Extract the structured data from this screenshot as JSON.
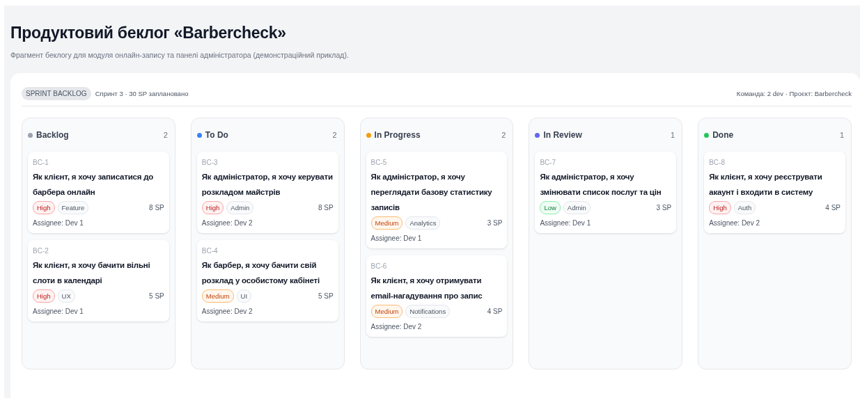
{
  "title": "Продуктовий беклог «Barbercheck»",
  "subtitle": "Фрагмент беклогу для модуля онлайн-запису та панелі адміністратора (демонстраційний приклад).",
  "board": {
    "badge": "SPRINT BACKLOG",
    "sprint": "Спринт 3 · 30 SP заплановано",
    "meta": "Команда: 2 dev · Проєкт: Barbercheck",
    "columns": [
      {
        "name": "Backlog",
        "color": "#9ca3af",
        "count": "2",
        "cards": [
          {
            "id": "BC-1",
            "title": "Як клієнт, я хочу записатися до барбера онлайн",
            "priority": {
              "label": "High",
              "kind": "high"
            },
            "tag": "Feature",
            "points": "8 SP",
            "assignee": "Assignee: Dev 1"
          },
          {
            "id": "BC-2",
            "title": "Як клієнт, я хочу бачити вільні слоти в календарі",
            "priority": {
              "label": "High",
              "kind": "high"
            },
            "tag": "UX",
            "points": "5 SP",
            "assignee": "Assignee: Dev 1"
          }
        ]
      },
      {
        "name": "To Do",
        "color": "#3b82f6",
        "count": "2",
        "cards": [
          {
            "id": "BC-3",
            "title": "Як адміністратор, я хочу керувати розкладом майстрів",
            "priority": {
              "label": "High",
              "kind": "high"
            },
            "tag": "Admin",
            "points": "8 SP",
            "assignee": "Assignee: Dev 2"
          },
          {
            "id": "BC-4",
            "title": "Як барбер, я хочу бачити свій розклад у особистому кабінеті",
            "priority": {
              "label": "Medium",
              "kind": "medium"
            },
            "tag": "UI",
            "points": "5 SP",
            "assignee": "Assignee: Dev 2"
          }
        ]
      },
      {
        "name": "In Progress",
        "color": "#f59e0b",
        "count": "2",
        "cards": [
          {
            "id": "BC-5",
            "title": "Як адміністратор, я хочу переглядати базову статистику записів",
            "priority": {
              "label": "Medium",
              "kind": "medium"
            },
            "tag": "Analytics",
            "points": "3 SP",
            "assignee": "Assignee: Dev 1"
          },
          {
            "id": "BC-6",
            "title": "Як клієнт, я хочу отримувати email-нагадування про запис",
            "priority": {
              "label": "Medium",
              "kind": "medium"
            },
            "tag": "Notifications",
            "points": "4 SP",
            "assignee": "Assignee: Dev 2"
          }
        ]
      },
      {
        "name": "In Review",
        "color": "#6366f1",
        "count": "1",
        "cards": [
          {
            "id": "BC-7",
            "title": "Як адміністратор, я хочу змінювати список послуг та цін",
            "priority": {
              "label": "Low",
              "kind": "low"
            },
            "tag": "Admin",
            "points": "3 SP",
            "assignee": "Assignee: Dev 1"
          }
        ]
      },
      {
        "name": "Done",
        "color": "#22c55e",
        "count": "1",
        "cards": [
          {
            "id": "BC-8",
            "title": "Як клієнт, я хочу реєструвати акаунт і входити в систему",
            "priority": {
              "label": "High",
              "kind": "high"
            },
            "tag": "Auth",
            "points": "4 SP",
            "assignee": "Assignee: Dev 2"
          }
        ]
      }
    ]
  }
}
